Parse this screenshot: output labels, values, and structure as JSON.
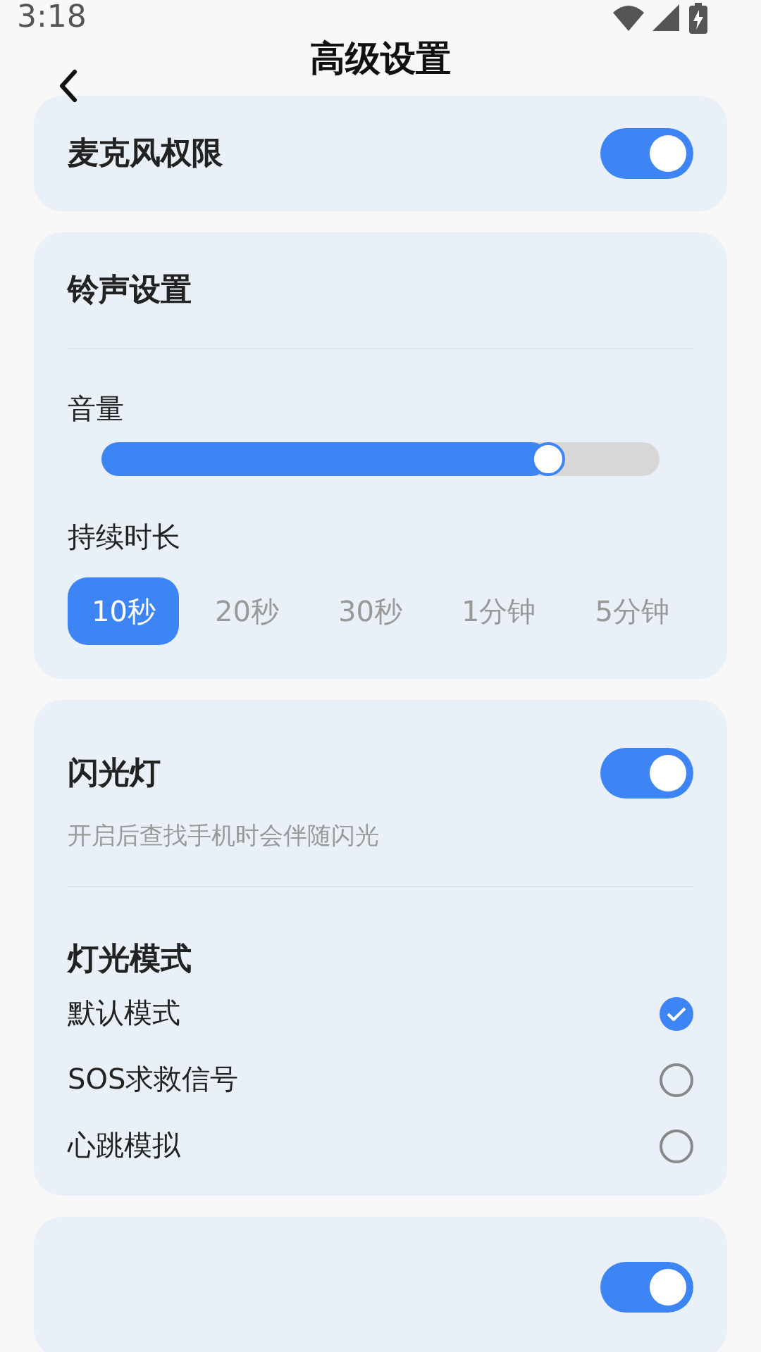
{
  "status_bar": {
    "time": "3:18"
  },
  "header": {
    "title": "高级设置"
  },
  "microphone": {
    "label": "麦克风权限",
    "on": true
  },
  "ringtone": {
    "title": "铃声设置",
    "volume_label": "音量",
    "volume": {
      "level": 0.8
    },
    "duration_label": "持续时长",
    "durations": [
      {
        "label": "10秒",
        "selected": true
      },
      {
        "label": "20秒",
        "selected": false
      },
      {
        "label": "30秒",
        "selected": false
      },
      {
        "label": "1分钟",
        "selected": false
      },
      {
        "label": "5分钟",
        "selected": false
      }
    ]
  },
  "flashlight": {
    "label": "闪光灯",
    "description": "开启后查找手机时会伴随闪光",
    "on": true,
    "mode_title": "灯光模式",
    "modes": [
      {
        "label": "默认模式",
        "selected": true
      },
      {
        "label": "SOS求救信号",
        "selected": false
      },
      {
        "label": "心跳模拟",
        "selected": false
      }
    ]
  },
  "next_card": {
    "on": true
  }
}
